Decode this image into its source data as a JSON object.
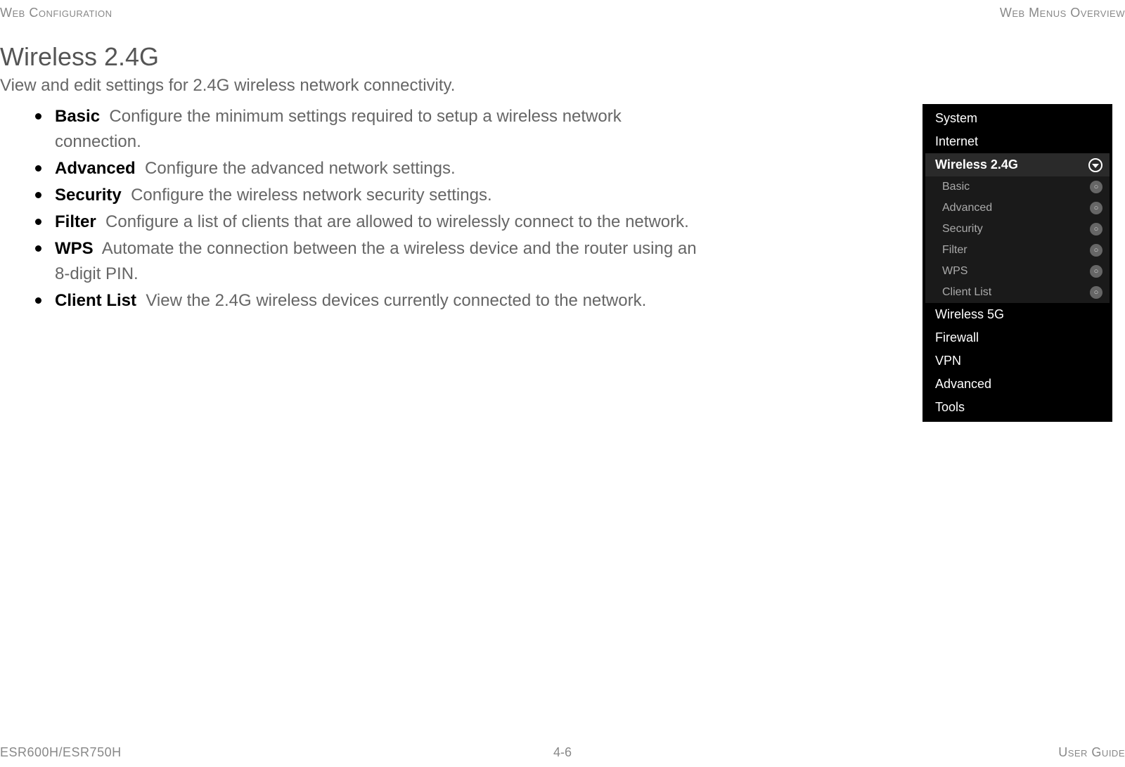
{
  "header": {
    "left": "Web Configuration",
    "right": "Web Menus Overview"
  },
  "title": "Wireless 2.4G",
  "subtitle": "View and edit settings for 2.4G wireless network connectivity.",
  "bullets": [
    {
      "term": "Basic",
      "desc": "Configure the minimum settings required to setup a wireless network connection."
    },
    {
      "term": "Advanced",
      "desc": "Configure the advanced network settings."
    },
    {
      "term": "Security",
      "desc": "Configure the wireless network security settings."
    },
    {
      "term": "Filter",
      "desc": "Configure a list of clients that are allowed to wirelessly connect to the network."
    },
    {
      "term": "WPS",
      "desc": "Automate the connection between the a wireless device and the router using an 8-digit PIN."
    },
    {
      "term": "Client List",
      "desc": "View the 2.4G wireless devices currently connected to the network."
    }
  ],
  "menu": {
    "items": [
      {
        "label": "System",
        "type": "top"
      },
      {
        "label": "Internet",
        "type": "top"
      },
      {
        "label": "Wireless 2.4G",
        "type": "active"
      },
      {
        "label": "Basic",
        "type": "sub"
      },
      {
        "label": "Advanced",
        "type": "sub"
      },
      {
        "label": "Security",
        "type": "sub"
      },
      {
        "label": "Filter",
        "type": "sub"
      },
      {
        "label": "WPS",
        "type": "sub"
      },
      {
        "label": "Client List",
        "type": "sub"
      },
      {
        "label": "Wireless 5G",
        "type": "top"
      },
      {
        "label": "Firewall",
        "type": "top"
      },
      {
        "label": "VPN",
        "type": "top"
      },
      {
        "label": "Advanced",
        "type": "top"
      },
      {
        "label": "Tools",
        "type": "top"
      }
    ]
  },
  "footer": {
    "left": "ESR600H/ESR750H",
    "center": "4-6",
    "right": "User Guide"
  }
}
